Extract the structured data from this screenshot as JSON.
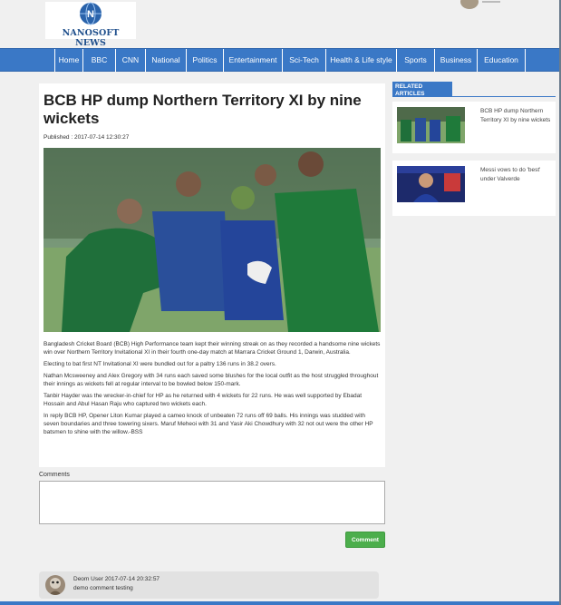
{
  "site": {
    "logo_text": "NANOSOFT NEWS"
  },
  "nav": {
    "items": [
      "Home",
      "BBC",
      "CNN",
      "National",
      "Politics",
      "Entertainment",
      "Sci-Tech",
      "Health & Life style",
      "Sports",
      "Business",
      "Education"
    ]
  },
  "article": {
    "title": "BCB HP dump Northern Territory XI by nine wickets",
    "published": "Published : 2017-07-14 12:30:27",
    "paragraphs": [
      "Bangladesh Cricket Board (BCB) High Performance team kept their winning streak on as they recorded a handsome nine wickets win over Northern Territory Invitational XI in their fourth one-day match at Marrara Cricket Ground 1, Darwin, Australia.",
      "Electing to bat first NT Invitational XI were bundled out for a paltry 136 runs in 38.2 overs.",
      "Nathan Mcsweeney and Alex Gregory with 34 runs each saved some blushes for the local outfit as the host struggled throughout their innings as wickets fell at regular interval to be bowled below 150-mark.",
      "Tanbir Hayder was the wrecker-in-chief for HP as he returned with 4 wickets for 22 runs. He was well supported by Ebadat Hossain and Abul Hasan Raju who captured two wickets each.",
      "In reply BCB HP, Opener Liton Kumar played a cameo knock of unbeaten 72 runs off 69 balls. His innings was studded with seven boundaries and three towering sixers. Maruf Meheoi with 31 and Yasir Aki Chowdhury with 32 not out were the other HP batsmen to shine with the willow.-BSS"
    ]
  },
  "comments": {
    "label": "Comments",
    "button_label": "Comment",
    "items": [
      {
        "user": "Deom User",
        "time": "2017-07-14 20:32:57",
        "text": "demo comment testing"
      }
    ]
  },
  "related": {
    "heading": "RELATED ARTICLES",
    "items": [
      {
        "title": "BCB HP dump Northern Territory XI by nine wickets"
      },
      {
        "title": "Messi vows to do 'best' under Valverde"
      }
    ]
  },
  "colors": {
    "nav_bg": "#3a78c6",
    "button_green": "#4cae4c",
    "page_bg": "#f0f0f0"
  }
}
